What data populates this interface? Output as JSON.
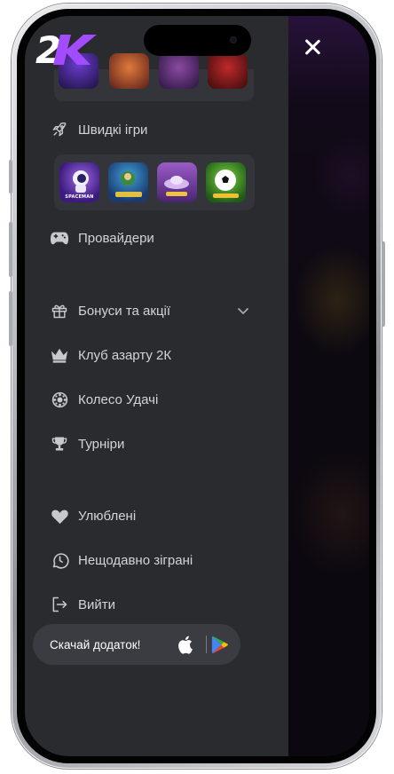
{
  "header": {
    "logo_text": "2K",
    "close_icon": "close-icon"
  },
  "top_strip": {
    "thumbnails": [
      {
        "name": "game-thumb",
        "color": "#4b2a8a"
      },
      {
        "name": "game-thumb",
        "color": "#b44d25"
      },
      {
        "name": "game-thumb",
        "color": "#6b3a7a"
      },
      {
        "name": "game-thumb",
        "color": "#8c1e1a"
      }
    ]
  },
  "menu": {
    "quick_games": {
      "label": "Швидкі ігри",
      "icon": "rocket-icon"
    },
    "quick_games_thumbs": [
      {
        "label": "SPACEMAN",
        "bg": "#5b2fa6"
      },
      {
        "label": "",
        "bg": "#2a6aa8"
      },
      {
        "label": "",
        "bg": "#6a3c8e"
      },
      {
        "label": "",
        "bg": "#2f7a2a"
      }
    ],
    "providers": {
      "label": "Провайдери",
      "icon": "gamepad-icon"
    },
    "bonuses": {
      "label": "Бонуси та акції",
      "icon": "gift-icon"
    },
    "club": {
      "label": "Клуб азарту 2К",
      "icon": "crown-icon"
    },
    "wheel": {
      "label": "Колесо Удачі",
      "icon": "wheel-icon"
    },
    "tournaments": {
      "label": "Турніри",
      "icon": "trophy-icon"
    },
    "favorites": {
      "label": "Улюблені",
      "icon": "heart-icon"
    },
    "recent": {
      "label": "Нещодавно зіграні",
      "icon": "history-icon"
    },
    "logout": {
      "label": "Вийти",
      "icon": "logout-icon"
    }
  },
  "app_download": {
    "label": "Скачай додаток!",
    "apple_icon": "apple-icon",
    "play_icon": "google-play-icon"
  },
  "colors": {
    "drawer_bg": "#2a2b2f",
    "accent_purple": "#a24bff",
    "text": "#d3d4d8"
  }
}
